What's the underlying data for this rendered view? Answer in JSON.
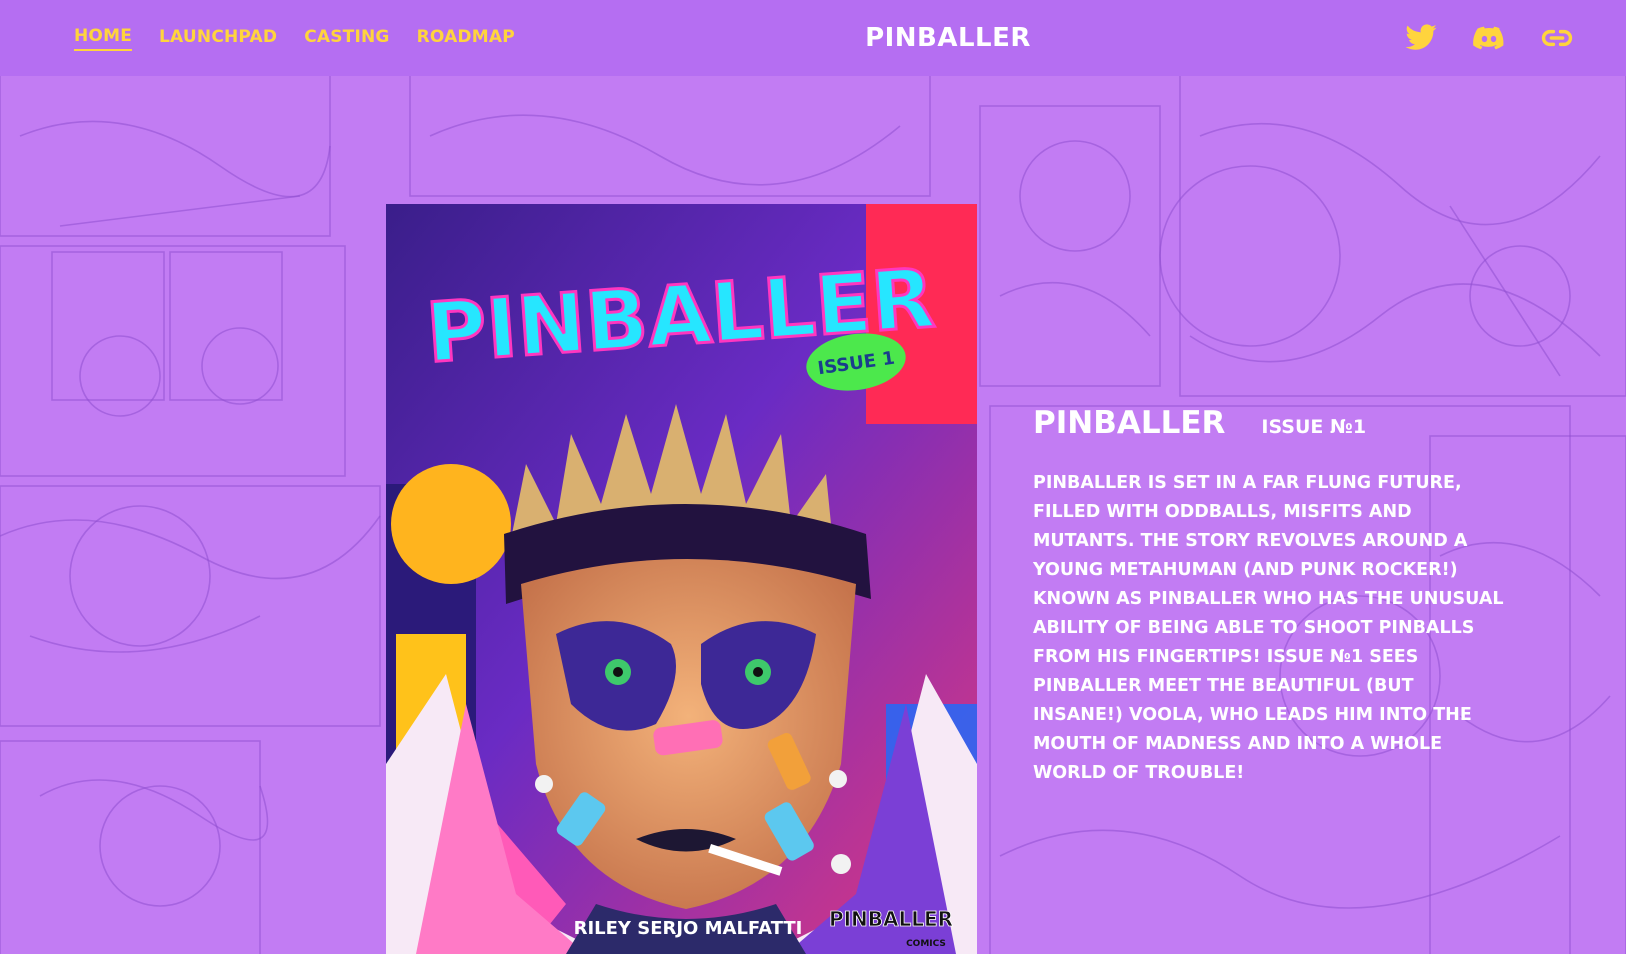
{
  "nav": {
    "links": [
      {
        "label": "HOME",
        "active": true
      },
      {
        "label": "LAUNCHPAD",
        "active": false
      },
      {
        "label": "CASTING",
        "active": false
      },
      {
        "label": "ROADMAP",
        "active": false
      }
    ],
    "brand": "PINBALLER",
    "social_icons": [
      "twitter-icon",
      "discord-icon",
      "link-icon"
    ]
  },
  "cover": {
    "title_art": "PINBALLER",
    "badge": "ISSUE 1",
    "author": "RILEY SERJO MALFATTI",
    "publisher_logo": "PINBALLER",
    "publisher_sub": "COMICS"
  },
  "info": {
    "title": "PINBALLER",
    "issue": "ISSUE №1",
    "description": "PINBALLER IS SET IN A FAR FLUNG FUTURE, FILLED WITH ODDBALLS, MISFITS AND MUTANTS. THE STORY REVOLVES AROUND A YOUNG METAHUMAN (AND PUNK ROCKER!) KNOWN AS PINBALLER WHO HAS THE UNUSUAL ABILITY OF BEING ABLE TO SHOOT PINBALLS FROM HIS FINGERTIPS! ISSUE №1 SEES PINBALLER MEET THE BEAUTIFUL (BUT INSANE!) VOOLA, WHO LEADS HIM INTO THE MOUTH OF MADNESS AND INTO A WHOLE WORLD OF TROUBLE!"
  },
  "colors": {
    "nav_bg": "#b56ef2",
    "page_bg": "#c27cf3",
    "accent": "#ffd43d",
    "text": "#ffffff"
  }
}
